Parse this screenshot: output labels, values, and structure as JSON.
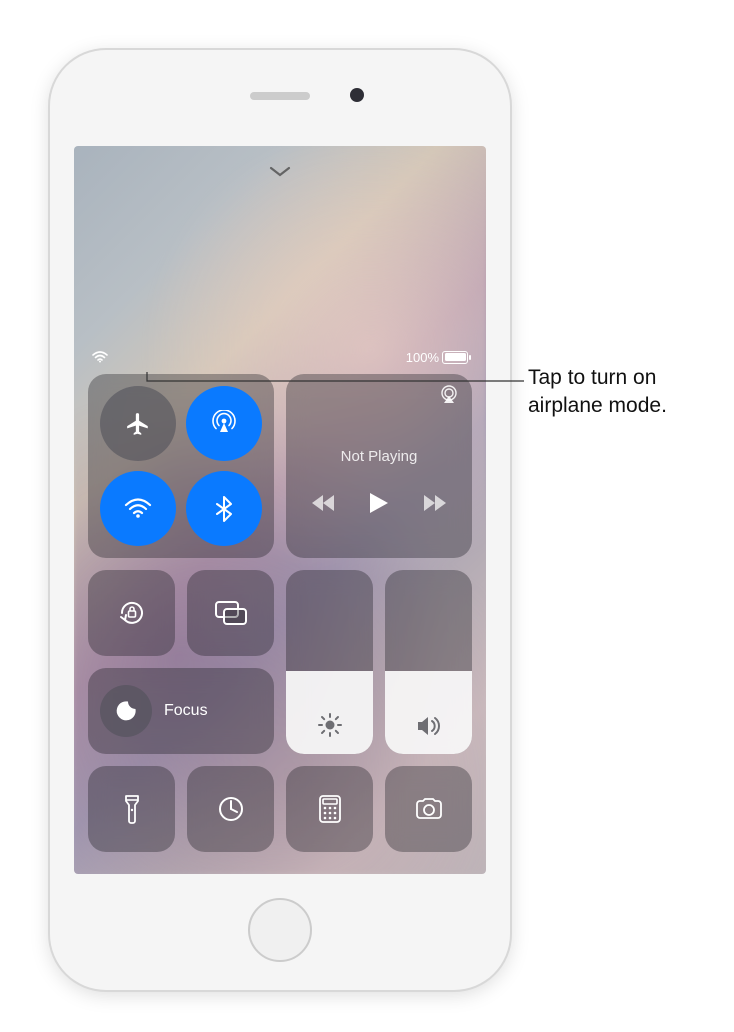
{
  "callout": {
    "text": "Tap to turn on airplane mode."
  },
  "status": {
    "battery_pct": "100%"
  },
  "media": {
    "title": "Not Playing"
  },
  "focus": {
    "label": "Focus"
  },
  "sliders": {
    "brightness_pct": 45,
    "volume_pct": 45
  },
  "connectivity": {
    "airplane_active": false,
    "airdrop_active": true,
    "wifi_active": true,
    "bluetooth_active": true
  }
}
